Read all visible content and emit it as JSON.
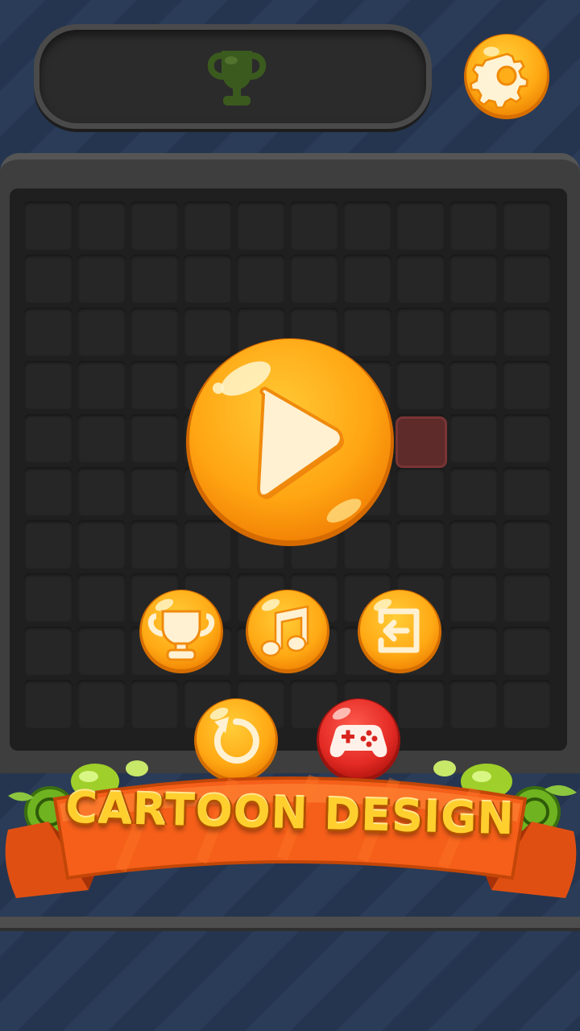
{
  "banner": {
    "text": "CARTOON DESIGN"
  },
  "grid": {
    "rows": 10,
    "cols": 10
  },
  "icons": {
    "top_trophy": "trophy-icon",
    "settings": "gear-icon",
    "play": "play-icon",
    "leaderboard": "trophy-icon",
    "music": "music-note-icon",
    "exit": "exit-icon",
    "restart": "restart-icon",
    "games": "gamepad-icon"
  },
  "colors": {
    "button_orange": "#ffb21a",
    "button_red": "#e0262a",
    "ribbon": "#f05a16",
    "ribbon_text": "#ffcf2e"
  }
}
